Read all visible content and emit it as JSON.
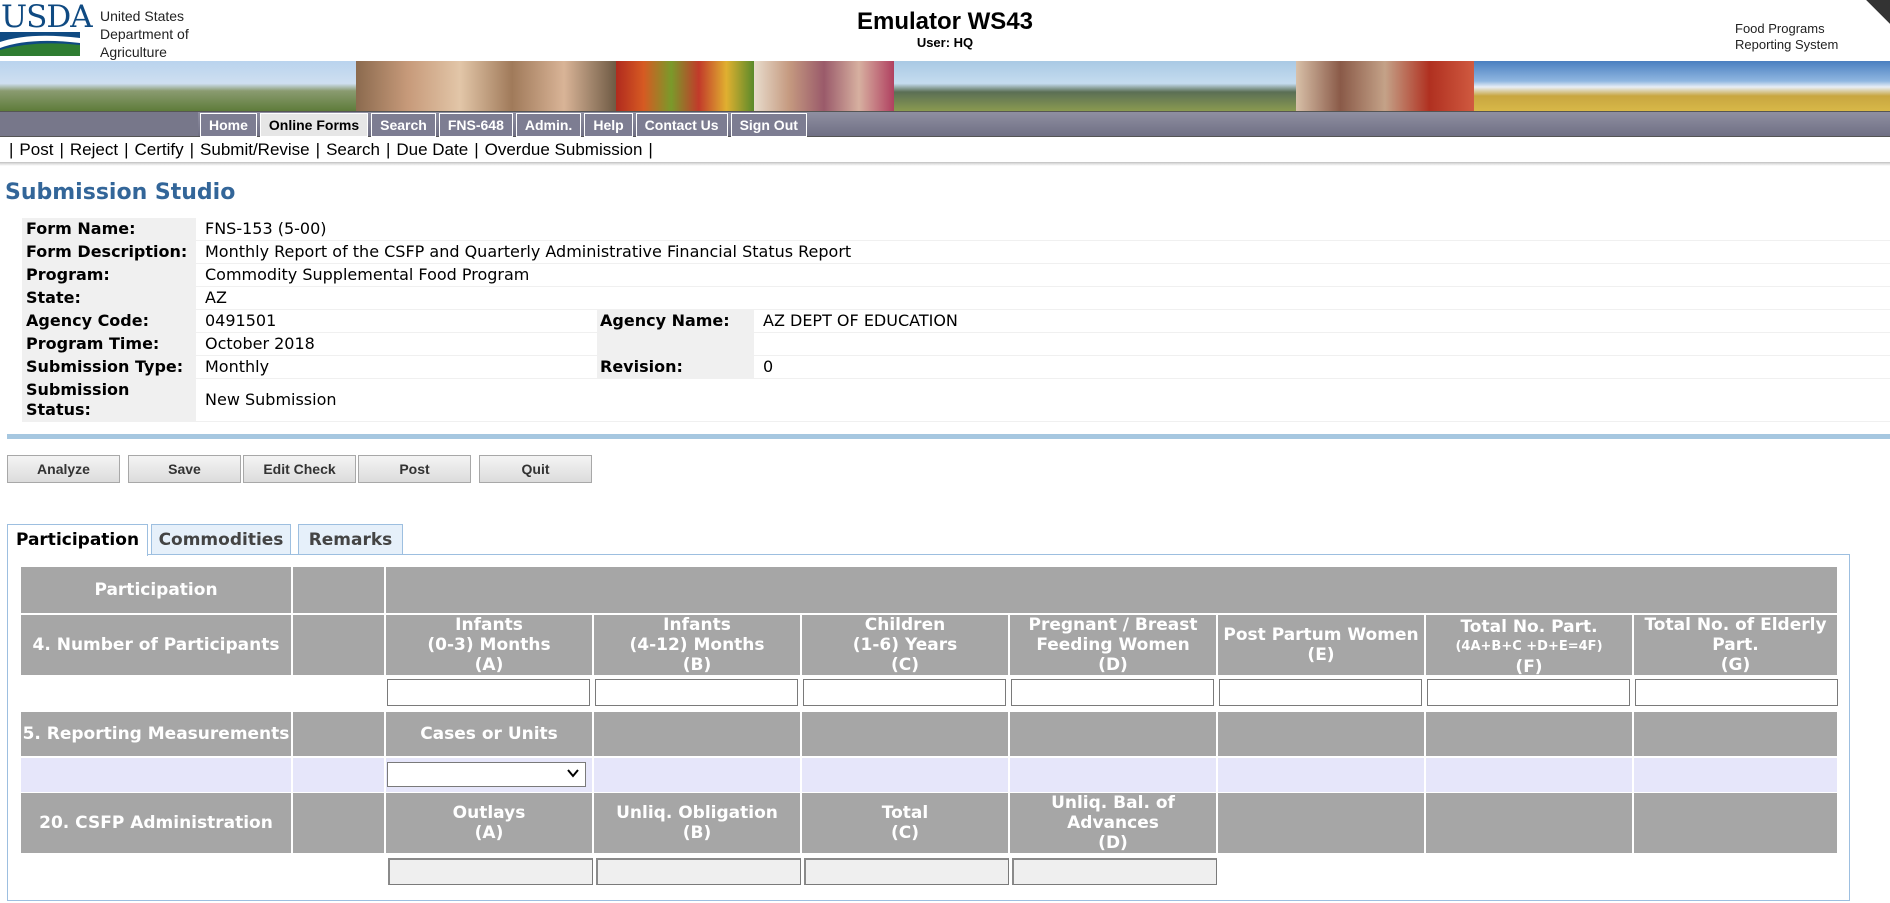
{
  "header": {
    "logo_text": "USDA",
    "agency_lines": [
      "United States",
      "Department of",
      "Agriculture"
    ],
    "title": "Emulator WS43",
    "user": "User: HQ",
    "system_lines": [
      "Food Programs",
      "Reporting System"
    ]
  },
  "nav": {
    "items": [
      {
        "label": "Home",
        "active": false
      },
      {
        "label": "Online Forms",
        "active": true
      },
      {
        "label": "Search",
        "active": false
      },
      {
        "label": "FNS-648",
        "active": false
      },
      {
        "label": "Admin.",
        "active": false
      },
      {
        "label": "Help",
        "active": false
      },
      {
        "label": "Contact Us",
        "active": false
      },
      {
        "label": "Sign Out",
        "active": false
      }
    ]
  },
  "subnav": {
    "items": [
      "Post",
      "Reject",
      "Certify",
      "Submit/Revise",
      "Search",
      "Due Date",
      "Overdue Submission"
    ]
  },
  "page": {
    "title": "Submission Studio"
  },
  "form_info": {
    "form_name_label": "Form Name:",
    "form_name": "FNS-153 (5-00)",
    "form_description_label": "Form Description:",
    "form_description": "Monthly Report of the CSFP and Quarterly Administrative Financial Status Report",
    "program_label": "Program:",
    "program": "Commodity Supplemental Food Program",
    "state_label": "State:",
    "state": "AZ",
    "agency_code_label": "Agency Code:",
    "agency_code": "0491501",
    "agency_name_label": "Agency Name:",
    "agency_name": "AZ DEPT OF EDUCATION",
    "program_time_label": "Program Time:",
    "program_time": "October 2018",
    "submission_type_label": "Submission Type:",
    "submission_type": "Monthly",
    "revision_label": "Revision:",
    "revision": "0",
    "submission_status_label_1": "Submission",
    "submission_status_label_2": "Status:",
    "submission_status": "New Submission"
  },
  "actions": {
    "analyze": "Analyze",
    "save": "Save",
    "edit_check": "Edit Check",
    "post": "Post",
    "quit": "Quit"
  },
  "tabs": [
    {
      "label": "Participation",
      "active": true
    },
    {
      "label": "Commodities",
      "active": false
    },
    {
      "label": "Remarks",
      "active": false
    }
  ],
  "grid": {
    "section_title": "Participation",
    "participants": {
      "label": "4. Number of Participants",
      "columns": [
        {
          "l1": "Infants",
          "l2": "(0-3) Months",
          "l3": "(A)"
        },
        {
          "l1": "Infants",
          "l2": "(4-12) Months",
          "l3": "(B)"
        },
        {
          "l1": "Children",
          "l2": "(1-6) Years",
          "l3": "(C)"
        },
        {
          "l1": "Pregnant / Breast",
          "l2": "Feeding Women",
          "l3": "(D)"
        },
        {
          "l1": "Post Partum Women",
          "l2": "(E)",
          "l3": ""
        },
        {
          "l1": "Total No. Part.",
          "l2": "(4A+B+C +D+E=4F)",
          "l3": "(F)"
        },
        {
          "l1": "Total No. of Elderly",
          "l2": "Part.",
          "l3": "(G)"
        }
      ],
      "values": [
        "",
        "",
        "",
        "",
        "",
        "",
        ""
      ]
    },
    "reporting": {
      "label": "5. Reporting Measurements",
      "column": "Cases or Units",
      "selected": ""
    },
    "admin": {
      "label": "20. CSFP Administration",
      "columns": [
        {
          "l1": "Outlays",
          "l2": "(A)",
          "l3": ""
        },
        {
          "l1": "Unliq. Obligation",
          "l2": "(B)",
          "l3": ""
        },
        {
          "l1": "Total",
          "l2": "(C)",
          "l3": ""
        },
        {
          "l1": "Unliq. Bal. of",
          "l2": "Advances",
          "l3": "(D)"
        }
      ],
      "values": [
        "",
        "",
        "",
        ""
      ]
    }
  }
}
